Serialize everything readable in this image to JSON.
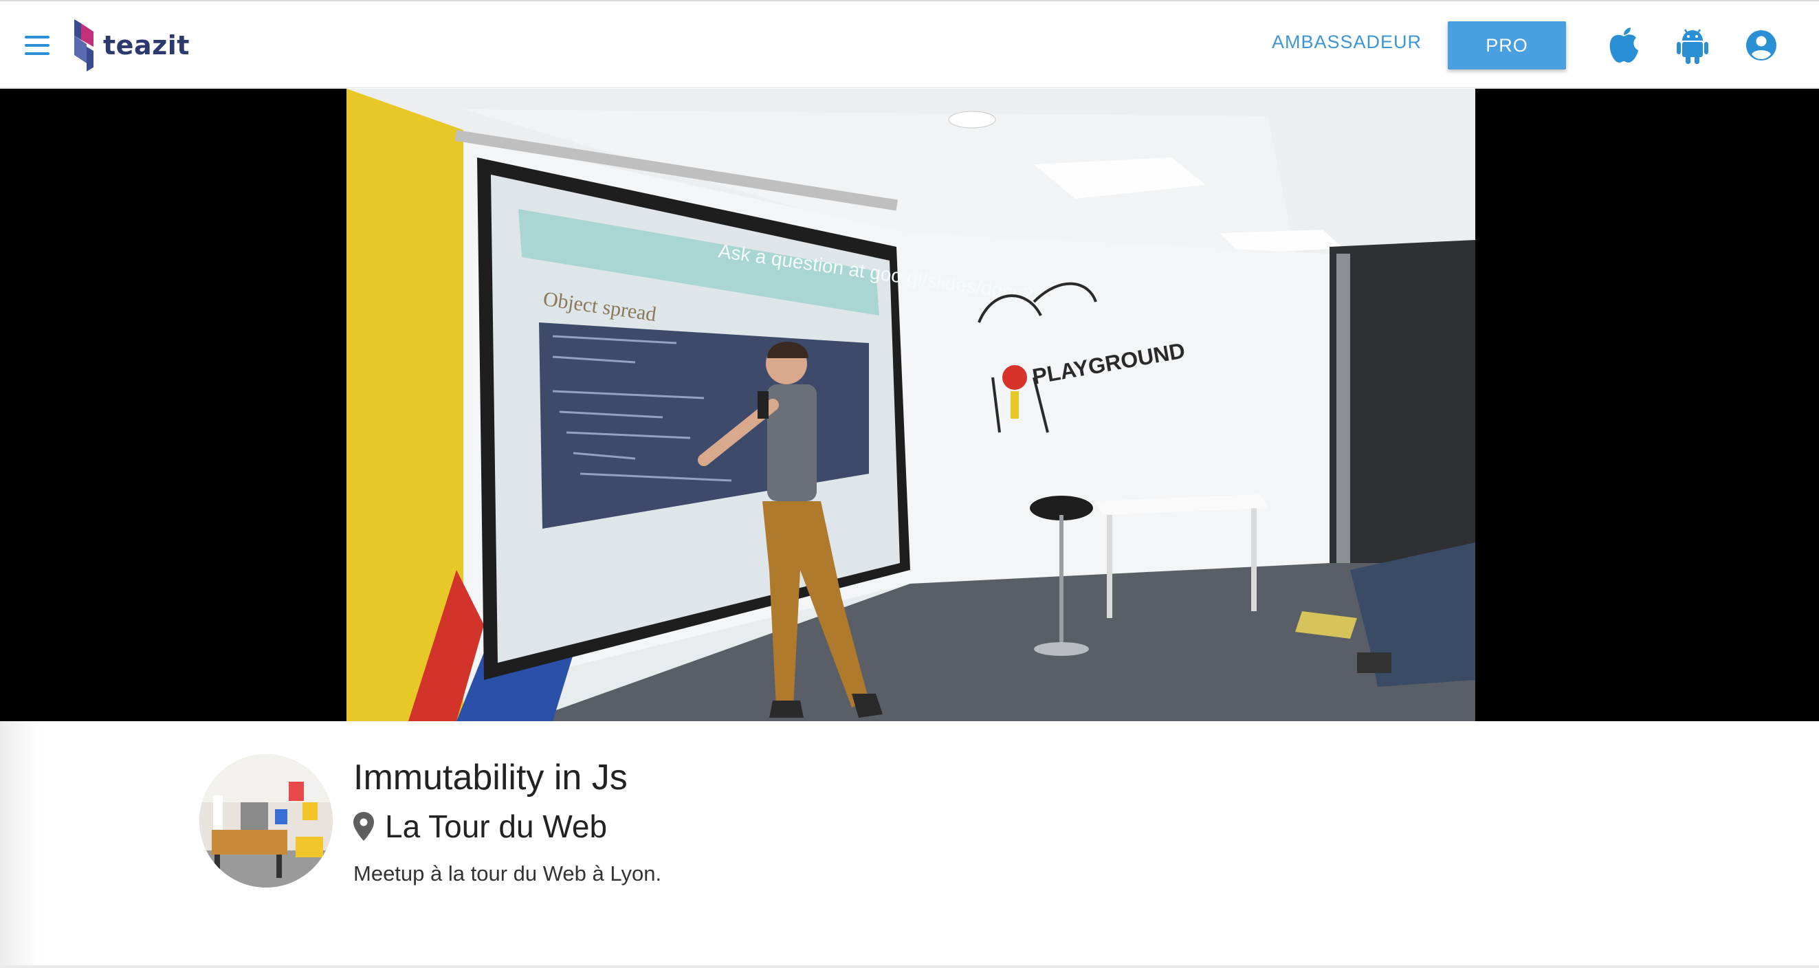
{
  "header": {
    "logo_text": "teazit",
    "ambassador_label": "AMBASSADEUR",
    "pro_label": "PRO",
    "icons": [
      "menu-icon",
      "apple-icon",
      "android-icon",
      "account-icon"
    ],
    "accent_color": "#4a9fe0"
  },
  "media": {
    "slide_header": "Ask a question at goo.gl/slides/dqcp2e",
    "slide_title": "Object spread",
    "wall_text": "PLAYGROUND"
  },
  "event": {
    "title": "Immutability in Js",
    "location": "La Tour du Web",
    "description": "Meetup à la tour du Web à Lyon."
  }
}
